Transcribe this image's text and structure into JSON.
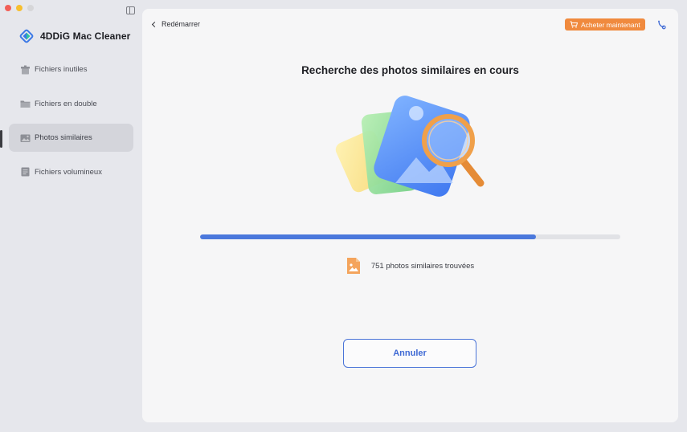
{
  "app": {
    "name": "4DDiG Mac Cleaner",
    "logo_icon": "4ddig-logo-icon"
  },
  "sidebar": {
    "items": [
      {
        "label": "Fichiers inutiles",
        "icon": "junk-files-icon",
        "active": false
      },
      {
        "label": "Fichiers en double",
        "icon": "folder-icon",
        "active": false
      },
      {
        "label": "Photos similaires",
        "icon": "photo-icon",
        "active": true
      },
      {
        "label": "Fichiers volumineux",
        "icon": "large-file-icon",
        "active": false
      }
    ]
  },
  "header": {
    "back_label": "Redémarrer",
    "buy_label": "Acheter maintenant"
  },
  "main": {
    "title": "Recherche des photos similaires en cours",
    "progress": 0.8,
    "found_text": "751 photos similaires trouvées",
    "cancel_label": "Annuler"
  },
  "colors": {
    "accent": "#4b78dc",
    "buy": "#f08a3e",
    "active_item": "#d4d5db"
  }
}
